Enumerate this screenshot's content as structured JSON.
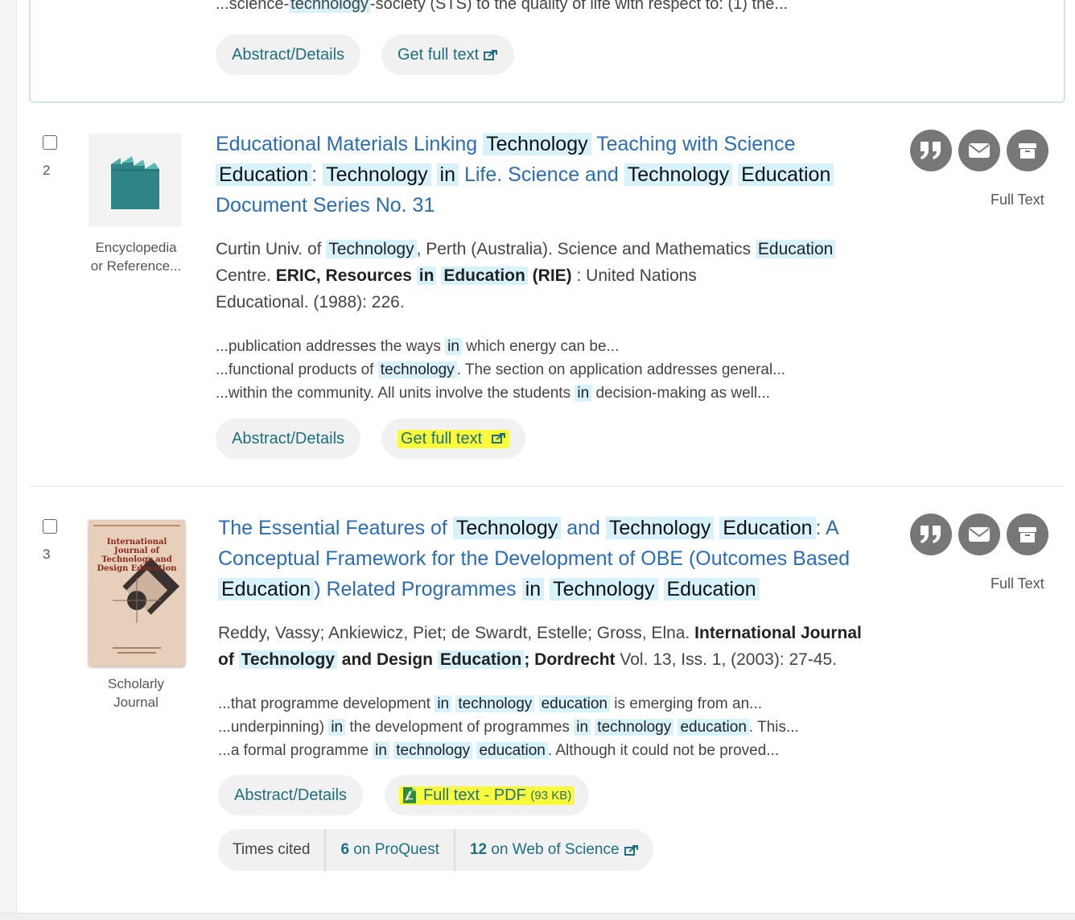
{
  "prev": {
    "snippet_start": "...science-",
    "snippet_kw": "technology",
    "snippet_end": "-society (STS) to the quality of life with respect to: (1) the...",
    "abstract_label": "Abstract/Details",
    "fulltext_label": "Get full text"
  },
  "result2": {
    "number": "2",
    "type_line1": "Encyclopedia",
    "type_line2": "or Reference...",
    "title": {
      "p1": "Educational Materials Linking ",
      "k1": "Technology",
      "p2": " Teaching with Science ",
      "k2": "Education",
      "p3": ": ",
      "k3": "Technology",
      "p4": " ",
      "k4": "in",
      "p5": " Life. Science and ",
      "k5": "Technology",
      "p6": " ",
      "k6": "Education",
      "p7": "Document Series No. 31"
    },
    "meta": {
      "a1": "Curtin Univ. of ",
      "k1": "Technology",
      "a2": ", Perth (Australia). Science and Mathematics ",
      "k2": "Education",
      "a3": "Centre.",
      "b1": "ERIC, Resources",
      "k3": "in",
      "k4": "Education",
      "b2": "(RIE)",
      "a4": ": United Nations",
      "a5": "Educational. (1988): 226."
    },
    "snippets": [
      {
        "pre": "...publication addresses the ways ",
        "kw": "in",
        "post": " which energy can be..."
      },
      {
        "pre": "...functional products of ",
        "kw": "technology",
        "post": ". The section on application addresses general..."
      },
      {
        "pre": "...within the community. All units involve the students ",
        "kw": "in",
        "post": " decision-making as well..."
      }
    ],
    "abstract_label": "Abstract/Details",
    "fulltext_label": "Get full text",
    "fulltext_status": "Full Text"
  },
  "result3": {
    "number": "3",
    "type_line1": "Scholarly",
    "type_line2": "Journal",
    "cover_title": "International Journal of Technology and Design Education",
    "title": {
      "p1": "The Essential Features of ",
      "k1": "Technology",
      "p2": " and ",
      "k2": "Technology",
      "p3": " ",
      "k3": "Education",
      "p4": ": A",
      "p5": "Conceptual Framework for the Development of OBE (Outcomes Based",
      "k4": "Education",
      "p6": ") Related Programmes ",
      "k5": "in",
      "p7": " ",
      "k6": "Technology",
      "p8": " ",
      "k7": "Education"
    },
    "meta": {
      "a1": "Reddy, Vassy; Ankiewicz, Piet; de Swardt, Estelle; Gross, Elna.",
      "b1": "International Journal",
      "b2": "of",
      "k1": "Technology",
      "b3": "and Design",
      "k2": "Education",
      "b4": "; Dordrecht",
      "a2": "Vol. 13, Iss. 1,  (2003): 27-45."
    },
    "snippets": [
      {
        "pre": "...that programme development ",
        "kw1": "in",
        "mid1": " ",
        "kw2": "technology",
        "mid2": " ",
        "kw3": "education",
        "post": " is emerging from an..."
      },
      {
        "pre": "...underpinning) ",
        "kw1": "in",
        "mid1": " the development of programmes ",
        "kw2": "in",
        "mid2": " ",
        "kw3": "technology",
        "mid3": " ",
        "kw4": "education",
        "post": ". This..."
      },
      {
        "pre": "...a formal programme ",
        "kw1": "in",
        "mid1": " ",
        "kw2": "technology",
        "mid2": " ",
        "kw3": "education",
        "post": ". Although it could not be proved..."
      }
    ],
    "abstract_label": "Abstract/Details",
    "pdf_label": "Full text - PDF",
    "pdf_size": "(93 KB)",
    "fulltext_status": "Full Text",
    "times_cited_label": "Times cited",
    "proquest_count": "6",
    "proquest_label": "on ProQuest",
    "wos_count": "12",
    "wos_label": "on Web of Science"
  },
  "colors": {
    "link": "#2a6db5",
    "accent": "#1f6f7f",
    "highlight": "#d7f2fb",
    "marker": "#fbfb3c",
    "icon_bg": "#777777"
  }
}
